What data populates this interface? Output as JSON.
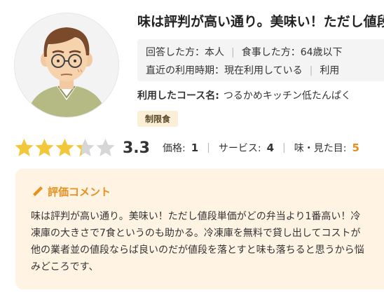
{
  "review": {
    "title": "味は評判が高い通り。美味い！ただし値段単価がどの弁当より",
    "info": {
      "row1": [
        "回答した方：本人",
        "食事した方：64歳以下"
      ],
      "row2": [
        "直近の利用時期：現在利用している",
        "利用"
      ]
    },
    "course_label": "利用したコース名:",
    "course_value": "つるかめキッチン低たんぱく",
    "tag": "制限食",
    "rating": {
      "stars": 3.3,
      "score": "3.3",
      "price_label": "価格:",
      "price_value": "1",
      "service_label": "サービス:",
      "service_value": "4",
      "taste_label": "味・見た目:",
      "taste_value": "5"
    },
    "comment": {
      "heading": "評価コメント",
      "body": "味は評判が高い通り。美味い！ただし値段単価がどの弁当より1番高い！冷凍庫の大きさで7食というのも助かる。冷凍庫を無料で貸し出してコストが他の業者並の値段ならば良いのだが値段を落とすと味も落ちると思うから悩みどころです、"
    },
    "colors": {
      "star_on": "#f3c73a",
      "star_off": "#d6d6d6",
      "accent": "#e8901f",
      "comment_bg": "#fff4e4",
      "tag_bg": "#fbefd8"
    }
  }
}
